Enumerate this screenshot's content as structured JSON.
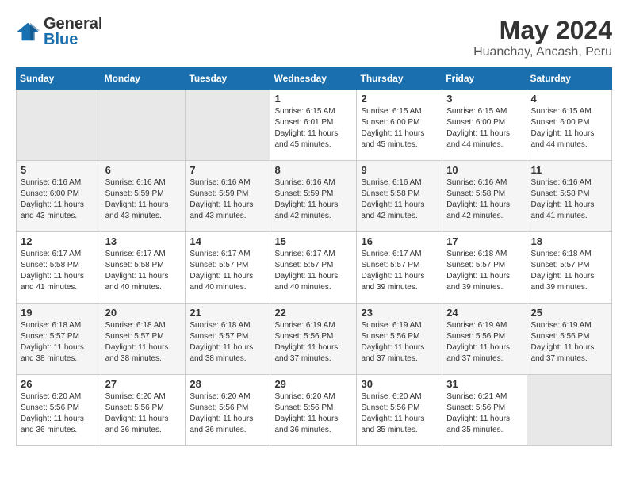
{
  "header": {
    "logo_general": "General",
    "logo_blue": "Blue",
    "month_title": "May 2024",
    "location": "Huanchay, Ancash, Peru"
  },
  "weekdays": [
    "Sunday",
    "Monday",
    "Tuesday",
    "Wednesday",
    "Thursday",
    "Friday",
    "Saturday"
  ],
  "weeks": [
    [
      {
        "day": "",
        "info": ""
      },
      {
        "day": "",
        "info": ""
      },
      {
        "day": "",
        "info": ""
      },
      {
        "day": "1",
        "info": "Sunrise: 6:15 AM\nSunset: 6:01 PM\nDaylight: 11 hours and 45 minutes."
      },
      {
        "day": "2",
        "info": "Sunrise: 6:15 AM\nSunset: 6:00 PM\nDaylight: 11 hours and 45 minutes."
      },
      {
        "day": "3",
        "info": "Sunrise: 6:15 AM\nSunset: 6:00 PM\nDaylight: 11 hours and 44 minutes."
      },
      {
        "day": "4",
        "info": "Sunrise: 6:15 AM\nSunset: 6:00 PM\nDaylight: 11 hours and 44 minutes."
      }
    ],
    [
      {
        "day": "5",
        "info": "Sunrise: 6:16 AM\nSunset: 6:00 PM\nDaylight: 11 hours and 43 minutes."
      },
      {
        "day": "6",
        "info": "Sunrise: 6:16 AM\nSunset: 5:59 PM\nDaylight: 11 hours and 43 minutes."
      },
      {
        "day": "7",
        "info": "Sunrise: 6:16 AM\nSunset: 5:59 PM\nDaylight: 11 hours and 43 minutes."
      },
      {
        "day": "8",
        "info": "Sunrise: 6:16 AM\nSunset: 5:59 PM\nDaylight: 11 hours and 42 minutes."
      },
      {
        "day": "9",
        "info": "Sunrise: 6:16 AM\nSunset: 5:58 PM\nDaylight: 11 hours and 42 minutes."
      },
      {
        "day": "10",
        "info": "Sunrise: 6:16 AM\nSunset: 5:58 PM\nDaylight: 11 hours and 42 minutes."
      },
      {
        "day": "11",
        "info": "Sunrise: 6:16 AM\nSunset: 5:58 PM\nDaylight: 11 hours and 41 minutes."
      }
    ],
    [
      {
        "day": "12",
        "info": "Sunrise: 6:17 AM\nSunset: 5:58 PM\nDaylight: 11 hours and 41 minutes."
      },
      {
        "day": "13",
        "info": "Sunrise: 6:17 AM\nSunset: 5:58 PM\nDaylight: 11 hours and 40 minutes."
      },
      {
        "day": "14",
        "info": "Sunrise: 6:17 AM\nSunset: 5:57 PM\nDaylight: 11 hours and 40 minutes."
      },
      {
        "day": "15",
        "info": "Sunrise: 6:17 AM\nSunset: 5:57 PM\nDaylight: 11 hours and 40 minutes."
      },
      {
        "day": "16",
        "info": "Sunrise: 6:17 AM\nSunset: 5:57 PM\nDaylight: 11 hours and 39 minutes."
      },
      {
        "day": "17",
        "info": "Sunrise: 6:18 AM\nSunset: 5:57 PM\nDaylight: 11 hours and 39 minutes."
      },
      {
        "day": "18",
        "info": "Sunrise: 6:18 AM\nSunset: 5:57 PM\nDaylight: 11 hours and 39 minutes."
      }
    ],
    [
      {
        "day": "19",
        "info": "Sunrise: 6:18 AM\nSunset: 5:57 PM\nDaylight: 11 hours and 38 minutes."
      },
      {
        "day": "20",
        "info": "Sunrise: 6:18 AM\nSunset: 5:57 PM\nDaylight: 11 hours and 38 minutes."
      },
      {
        "day": "21",
        "info": "Sunrise: 6:18 AM\nSunset: 5:57 PM\nDaylight: 11 hours and 38 minutes."
      },
      {
        "day": "22",
        "info": "Sunrise: 6:19 AM\nSunset: 5:56 PM\nDaylight: 11 hours and 37 minutes."
      },
      {
        "day": "23",
        "info": "Sunrise: 6:19 AM\nSunset: 5:56 PM\nDaylight: 11 hours and 37 minutes."
      },
      {
        "day": "24",
        "info": "Sunrise: 6:19 AM\nSunset: 5:56 PM\nDaylight: 11 hours and 37 minutes."
      },
      {
        "day": "25",
        "info": "Sunrise: 6:19 AM\nSunset: 5:56 PM\nDaylight: 11 hours and 37 minutes."
      }
    ],
    [
      {
        "day": "26",
        "info": "Sunrise: 6:20 AM\nSunset: 5:56 PM\nDaylight: 11 hours and 36 minutes."
      },
      {
        "day": "27",
        "info": "Sunrise: 6:20 AM\nSunset: 5:56 PM\nDaylight: 11 hours and 36 minutes."
      },
      {
        "day": "28",
        "info": "Sunrise: 6:20 AM\nSunset: 5:56 PM\nDaylight: 11 hours and 36 minutes."
      },
      {
        "day": "29",
        "info": "Sunrise: 6:20 AM\nSunset: 5:56 PM\nDaylight: 11 hours and 36 minutes."
      },
      {
        "day": "30",
        "info": "Sunrise: 6:20 AM\nSunset: 5:56 PM\nDaylight: 11 hours and 35 minutes."
      },
      {
        "day": "31",
        "info": "Sunrise: 6:21 AM\nSunset: 5:56 PM\nDaylight: 11 hours and 35 minutes."
      },
      {
        "day": "",
        "info": ""
      }
    ]
  ]
}
